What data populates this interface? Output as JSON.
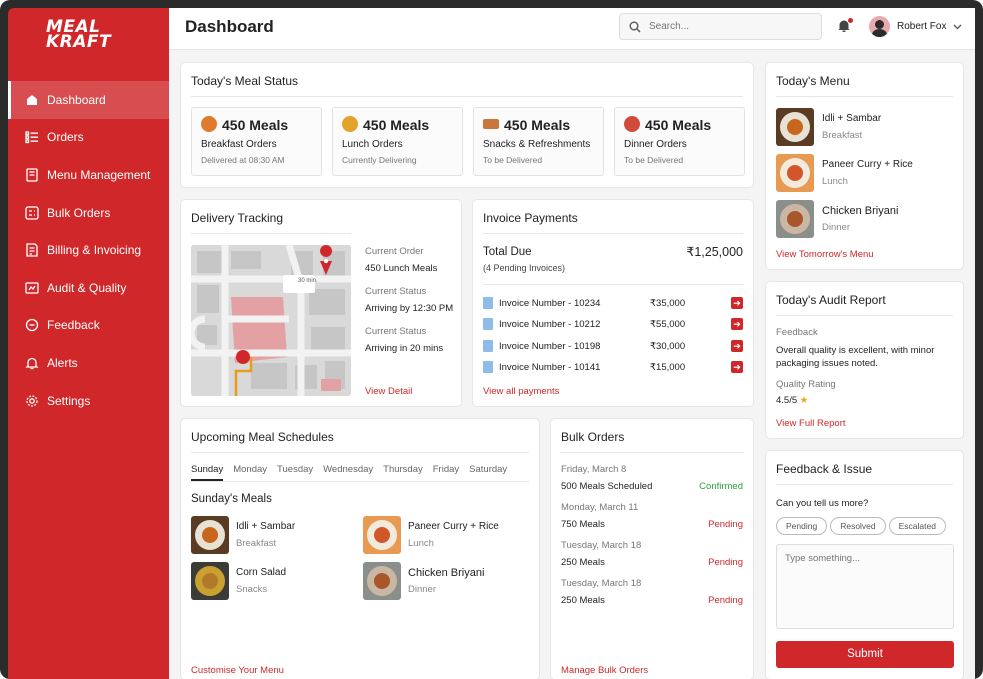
{
  "brand": {
    "logo_line1": "MEAL",
    "logo_line2": "KRAFT",
    "accent": "#d0282a"
  },
  "sidebar": {
    "items": [
      {
        "label": "Dashboard",
        "icon": "home-icon",
        "active": true
      },
      {
        "label": "Orders",
        "icon": "list-icon"
      },
      {
        "label": "Menu Management",
        "icon": "menu-book-icon"
      },
      {
        "label": "Bulk Orders",
        "icon": "grid-icon"
      },
      {
        "label": "Billing & Invoicing",
        "icon": "invoice-icon"
      },
      {
        "label": "Audit & Quality",
        "icon": "audit-icon"
      },
      {
        "label": "Feedback",
        "icon": "chat-icon"
      },
      {
        "label": "Alerts",
        "icon": "bell-icon"
      },
      {
        "label": "Settings",
        "icon": "gear-icon"
      }
    ]
  },
  "header": {
    "title": "Dashboard",
    "search_placeholder": "Search...",
    "user_name": "Robert Fox"
  },
  "meal_status": {
    "title": "Today's Meal Status",
    "boxes": [
      {
        "count": "450 Meals",
        "name": "Breakfast Orders",
        "status": "Delivered at 08:30 AM",
        "color": "#e07a2c"
      },
      {
        "count": "450 Meals",
        "name": "Lunch Orders",
        "status": "Currently Delivering",
        "color": "#e3a32a"
      },
      {
        "count": "450 Meals",
        "name": "Snacks & Refreshments",
        "status": "To be Delivered",
        "color": "#c9783a"
      },
      {
        "count": "450 Meals",
        "name": "Dinner Orders",
        "status": "To be Delivered",
        "color": "#d04b3a"
      }
    ]
  },
  "delivery": {
    "title": "Delivery Tracking",
    "map_tag": "30 min.",
    "rows": [
      {
        "label": "Current Order",
        "value": "450 Lunch Meals"
      },
      {
        "label": "Current Status",
        "value": "Arriving by 12:30 PM"
      },
      {
        "label": "Current Status",
        "value": "Arriving in 20 mins"
      }
    ],
    "link": "View Detail"
  },
  "invoice": {
    "title": "Invoice Payments",
    "total_label": "Total Due",
    "total_value": "₹1,25,000",
    "pending": "(4 Pending Invoices)",
    "rows": [
      {
        "label": "Invoice Number - 10234",
        "amount": "₹35,000"
      },
      {
        "label": "Invoice Number - 10212",
        "amount": "₹55,000"
      },
      {
        "label": "Invoice Number - 10198",
        "amount": "₹30,000"
      },
      {
        "label": "Invoice Number - 10141",
        "amount": "₹15,000"
      }
    ],
    "link": "View all payments"
  },
  "today_menu": {
    "title": "Today's Menu",
    "items": [
      {
        "name": "Idli + Sambar",
        "meal": "Breakfast"
      },
      {
        "name": "Paneer Curry + Rice",
        "meal": "Lunch"
      },
      {
        "name": "Chicken Briyani",
        "meal": "Dinner"
      }
    ],
    "link": "View Tomorrow's Menu"
  },
  "audit": {
    "title": "Today's Audit Report",
    "feedback_label": "Feedback",
    "feedback_text": "Overall quality is excellent, with minor packaging issues noted.",
    "rating_label": "Quality Rating",
    "rating": "4.5/5",
    "star": "★",
    "link": "View Full Report"
  },
  "schedule": {
    "title": "Upcoming Meal Schedules",
    "days": [
      "Sunday",
      "Monday",
      "Tuesday",
      "Wednesday",
      "Thursday",
      "Friday",
      "Saturday"
    ],
    "subtitle": "Sunday's Meals",
    "items": [
      {
        "name": "Idli + Sambar",
        "meal": "Breakfast"
      },
      {
        "name": "Paneer Curry + Rice",
        "meal": "Lunch"
      },
      {
        "name": "Corn Salad",
        "meal": "Snacks"
      },
      {
        "name": "Chicken Briyani",
        "meal": "Dinner"
      }
    ],
    "link": "Customise Your Menu"
  },
  "bulk": {
    "title": "Bulk Orders",
    "rows": [
      {
        "date": "Friday, March 8",
        "meals": "500 Meals Scheduled",
        "status": "Confirmed",
        "color": "#2e9e3e"
      },
      {
        "date": "Monday, March 11",
        "meals": "750 Meals",
        "status": "Pending",
        "color": "#d0282a"
      },
      {
        "date": "Tuesday, March 18",
        "meals": "250 Meals",
        "status": "Pending",
        "color": "#d0282a"
      },
      {
        "date": "Tuesday, March 18",
        "meals": "250 Meals",
        "status": "Pending",
        "color": "#d0282a"
      }
    ],
    "link": "Manage Bulk Orders"
  },
  "feedback": {
    "title": "Feedback & Issue",
    "question": "Can you tell us more?",
    "pills": [
      "Pending",
      "Resolved",
      "Escalated"
    ],
    "placeholder": "Type something...",
    "submit": "Submit"
  }
}
